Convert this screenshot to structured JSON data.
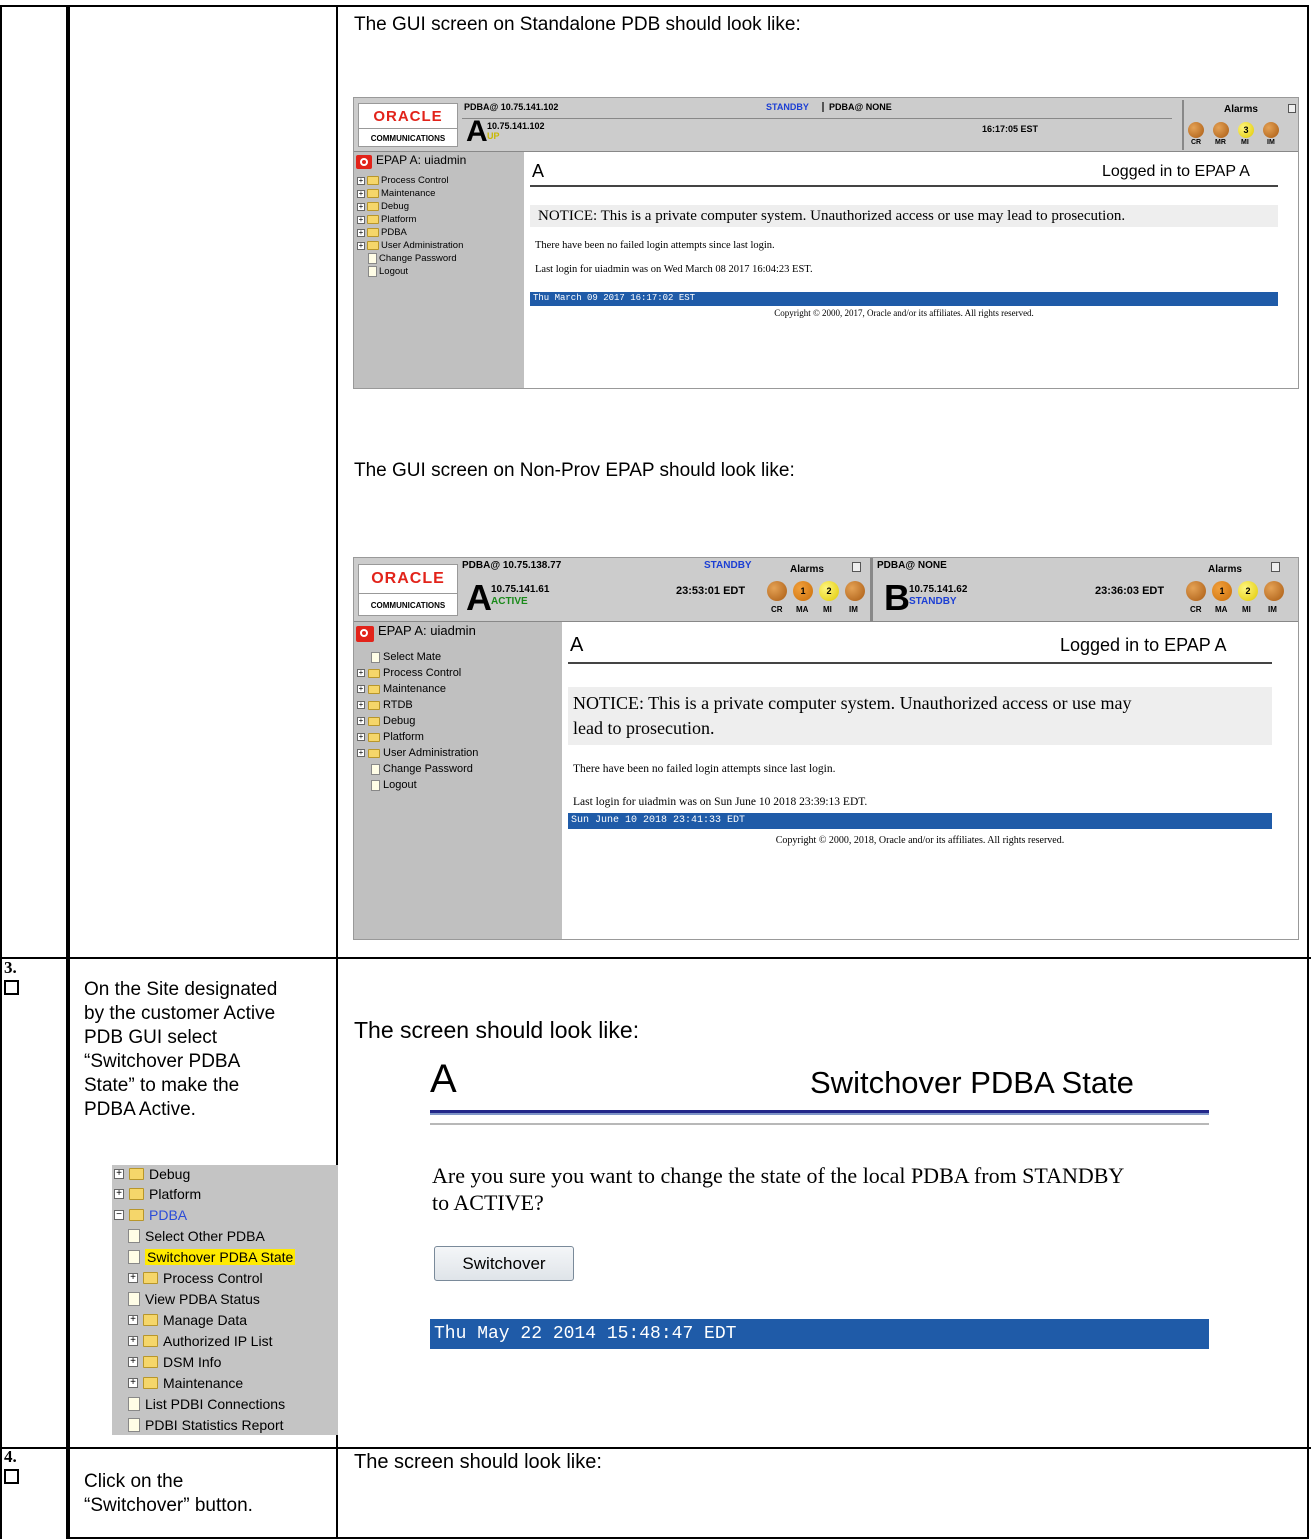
{
  "top_section": {
    "caption_standalone": "The GUI screen on Standalone PDB should look like:",
    "caption_nonprov": "The GUI screen on Non-Prov EPAP should look like:"
  },
  "shot1": {
    "oracle_text": "ORACLE",
    "communications_text": "COMMUNICATIONS",
    "pdba_left": "PDBA@ 10.75.141.102",
    "standby_label": "STANDBY",
    "pdba_right": "PDBA@ NONE",
    "alarms_label": "Alarms",
    "server_letter": "A",
    "server_ip": "10.75.141.102",
    "server_state": "UP",
    "time": "16:17:05 EST",
    "alarm_mi_count": "3",
    "alarm_labels": [
      "CR",
      "MR",
      "MI",
      "IM"
    ],
    "user_line": "EPAP A: uiadmin",
    "menu": [
      "Process Control",
      "Maintenance",
      "Debug",
      "Platform",
      "PDBA",
      "User Administration",
      "Change Password",
      "Logout"
    ],
    "pane_letter": "A",
    "logged_in": "Logged in to EPAP A",
    "notice": "NOTICE: This is a private computer system. Unauthorized access or use may lead to prosecution.",
    "failed_login": "There have been no failed login attempts since last login.",
    "last_login": "Last login for uiadmin was on Wed March 08 2017 16:04:23 EST.",
    "date_bar": "Thu March 09 2017 16:17:02 EST",
    "copyright": "Copyright © 2000, 2017, Oracle and/or its affiliates. All rights reserved."
  },
  "shot2": {
    "oracle_text": "ORACLE",
    "communications_text": "COMMUNICATIONS",
    "pdba_left": "PDBA@ 10.75.138.77",
    "standby_label": "STANDBY",
    "alarms_label": "Alarms",
    "pdba_right": "PDBA@ NONE",
    "alarms_label_right": "Alarms",
    "server_a_letter": "A",
    "server_a_ip": "10.75.141.61",
    "server_a_state": "ACTIVE",
    "time_a": "23:53:01 EDT",
    "alarm_a_ma": "1",
    "alarm_a_mi": "2",
    "server_b_letter": "B",
    "server_b_ip": "10.75.141.62",
    "server_b_state": "STANDBY",
    "time_b": "23:36:03 EDT",
    "alarm_b_ma": "1",
    "alarm_b_mi": "2",
    "alarm_labels": [
      "CR",
      "MA",
      "MI",
      "IM"
    ],
    "user_line": "EPAP A: uiadmin",
    "menu": [
      "Select Mate",
      "Process Control",
      "Maintenance",
      "RTDB",
      "Debug",
      "Platform",
      "User Administration",
      "Change Password",
      "Logout"
    ],
    "pane_letter": "A",
    "logged_in": "Logged in to EPAP A",
    "notice_line1": "NOTICE: This is a private computer system. Unauthorized access or use may",
    "notice_line2": "lead to prosecution.",
    "failed_login": "There have been no failed login attempts since last login.",
    "last_login": "Last login for uiadmin was on Sun June 10 2018 23:39:13 EDT.",
    "date_bar": "Sun June 10 2018 23:41:33 EDT",
    "copyright": "Copyright © 2000, 2018, Oracle and/or its affiliates. All rights reserved."
  },
  "step3": {
    "number": "3.",
    "instruction": [
      "On the Site designated",
      "by the customer Active",
      "PDB GUI select",
      "“Switchover PDBA",
      "State” to make the",
      "PDBA Active."
    ],
    "menu": {
      "debug": "Debug",
      "platform": "Platform",
      "pdba": "PDBA",
      "select_other": "Select Other PDBA",
      "switchover_state": "Switchover PDBA State",
      "process_control": "Process Control",
      "view_status": "View PDBA Status",
      "manage_data": "Manage Data",
      "authorized_ip": "Authorized IP List",
      "dsm_info": "DSM Info",
      "maintenance": "Maintenance",
      "list_connections": "List PDBI Connections",
      "stats_report": "PDBI Statistics Report"
    },
    "caption": "The screen should look like:",
    "pane_letter": "A",
    "title": "Switchover PDBA State",
    "question_line1": "Are you sure you want to change the state of the local PDBA from STANDBY",
    "question_line2": "to ACTIVE?",
    "button": "Switchover",
    "date_bar": "Thu May 22 2014 15:48:47 EDT"
  },
  "step4": {
    "number": "4.",
    "instruction": [
      "Click on the",
      "“Switchover” button."
    ],
    "caption": "The screen should look like:"
  }
}
